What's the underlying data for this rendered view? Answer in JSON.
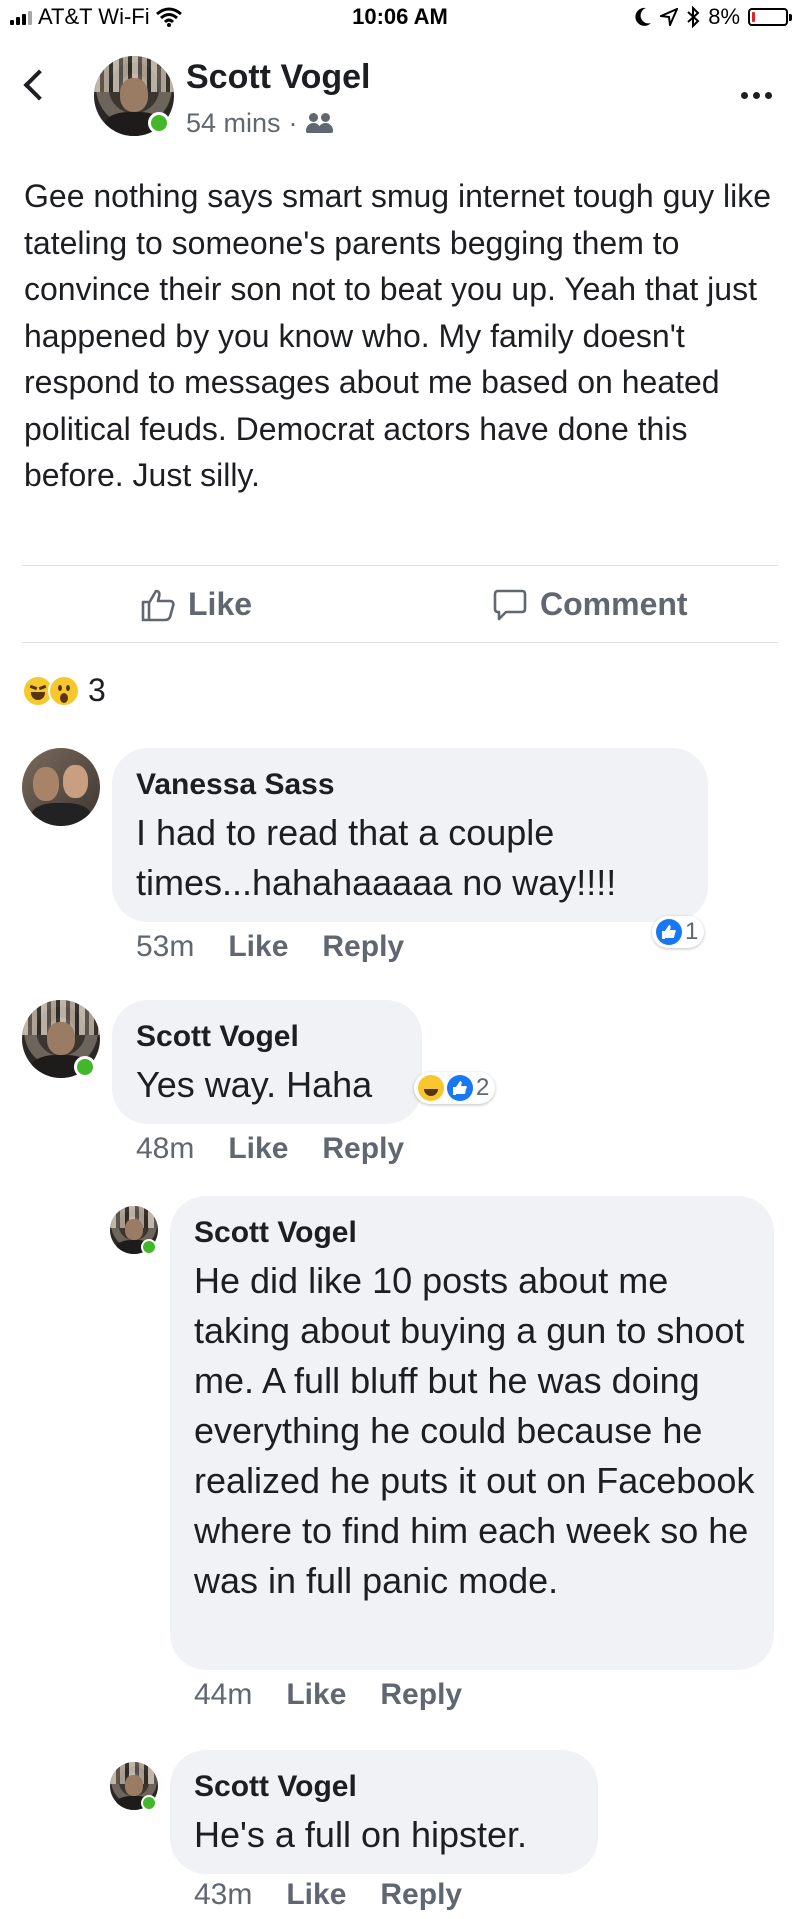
{
  "status_bar": {
    "carrier": "AT&T Wi-Fi",
    "time": "10:06 AM",
    "battery": "8%",
    "battery_level": 0.08
  },
  "post": {
    "author": "Scott Vogel",
    "time": "54 mins",
    "separator": "·",
    "audience_icon": "friends-icon",
    "text": "Gee nothing says smart smug internet tough guy like tateling to someone's parents begging them to convince their son not to beat you up. Yeah that just happened by you know who. My family doesn't respond to messages about me based on heated political feuds. Democrat actors have done this before. Just silly.",
    "actions": {
      "like": "Like",
      "comment": "Comment"
    },
    "reactions": {
      "types": [
        "haha",
        "wow"
      ],
      "count": "3"
    }
  },
  "comments": [
    {
      "author": "Vanessa Sass",
      "text": "I had to read that a couple times...hahahaaaaa no way!!!!",
      "time": "53m",
      "like": "Like",
      "reply": "Reply",
      "reaction_count": "1"
    },
    {
      "author": "Scott Vogel",
      "text": "Yes way. Haha",
      "time": "48m",
      "like": "Like",
      "reply": "Reply",
      "reaction_count": "2"
    }
  ],
  "replies": [
    {
      "author": "Scott Vogel",
      "text": "He did like 10 posts about me taking about buying a gun to shoot me. A full bluff but he was doing everything he could because he realized he puts it out on Facebook where to find him each week so he was in full panic mode.",
      "time": "44m",
      "like": "Like",
      "reply": "Reply"
    },
    {
      "author": "Scott Vogel",
      "text": "He's a full on hipster.",
      "time": "43m",
      "like": "Like",
      "reply": "Reply"
    }
  ],
  "colors": {
    "online": "#42b72a",
    "like_blue": "#1877f2",
    "bubble_bg": "#f0f2f5",
    "meta_text": "#606770"
  }
}
